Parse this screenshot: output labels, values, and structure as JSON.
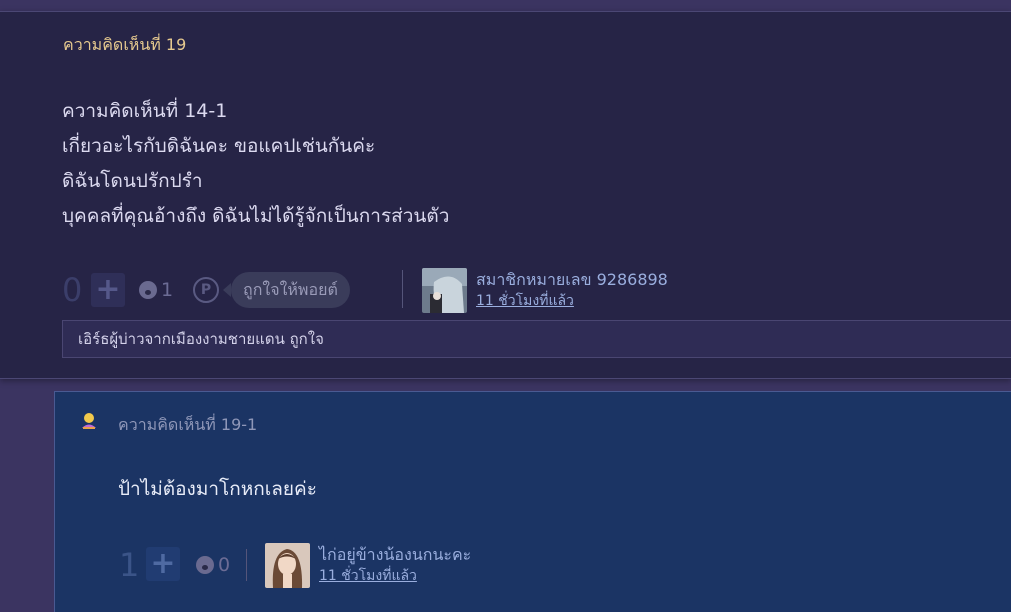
{
  "comment19": {
    "title": "ความคิดเห็นที่ 19",
    "body": [
      "ความคิดเห็นที่ 14-1",
      "เกี่ยวอะไรกับดิฉันคะ ขอแคปเช่นกันค่ะ",
      "ดิฉันโดนปรักปรำ",
      "บุคคลที่คุณอ้างถึง ดิฉันไม่ได้รู้จักเป็นการส่วนตัว"
    ],
    "vote_count": "0",
    "plus_label": "+",
    "emotion_count": "1",
    "point_label": "P",
    "like_tip": "ถูกใจให้พอยต์",
    "username": "สมาชิกหมายเลข 9286898",
    "time_ago": "11 ชั่วโมงที่แล้ว",
    "reaction_text": "เอิร์ธผู้บ่าวจากเมืองงามชายแดน ถูกใจ"
  },
  "comment19_1": {
    "title": "ความคิดเห็นที่ 19-1",
    "body": "ป้าไม่ต้องมาโกหกเลยค่ะ",
    "vote_count": "1",
    "plus_label": "+",
    "emotion_count": "0",
    "username": "ไก่อยู่ข้างน้องนกนะคะ",
    "time_ago": "11 ชั่วโมงที่แล้ว"
  },
  "colors": {
    "card19_bg": "#262446",
    "card19_1_bg": "#1b3464",
    "title_gold": "#e6c98f",
    "link_blue": "#9aaede"
  },
  "icons": [
    "plus-icon",
    "emotion-icon",
    "point-icon",
    "user-avatar-icon"
  ]
}
